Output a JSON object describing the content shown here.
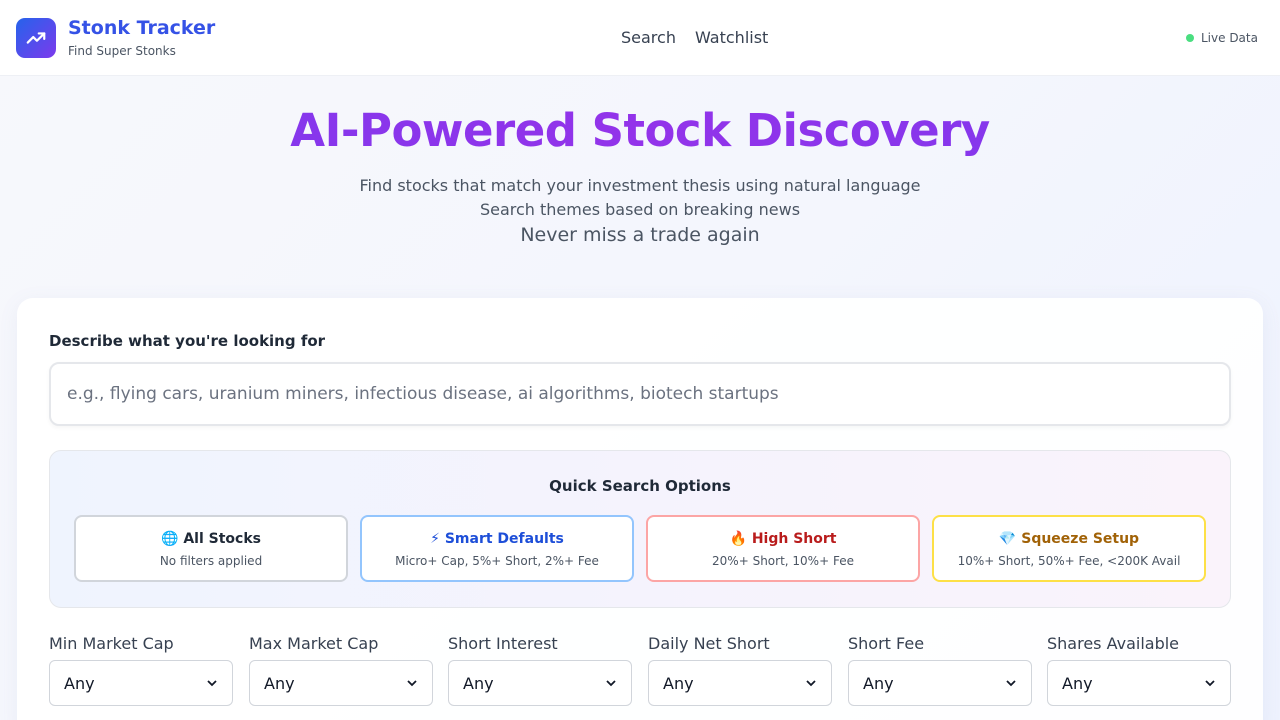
{
  "header": {
    "brand_title": "Stonk Tracker",
    "brand_subtitle": "Find Super Stonks",
    "nav": [
      "Search",
      "Watchlist"
    ],
    "status": "Live Data",
    "logo_icon": "trending-up-icon"
  },
  "hero": {
    "title": "AI-Powered Stock Discovery",
    "line1": "Find stocks that match your investment thesis using natural language",
    "line2": "Search themes based on breaking news",
    "line3": "Never miss a trade again"
  },
  "search": {
    "label": "Describe what you're looking for",
    "value": "",
    "placeholder": "e.g., flying cars, uranium miners, infectious disease, ai algorithms, biotech startups"
  },
  "quick": {
    "title": "Quick Search Options",
    "options": [
      {
        "icon": "🌐",
        "label": "All Stocks",
        "sub": "No filters applied",
        "color": "#1f2937",
        "border": "#d1d5db"
      },
      {
        "icon": "⚡",
        "label": "Smart Defaults",
        "sub": "Micro+ Cap, 5%+ Short, 2%+ Fee",
        "color": "#1d4ed8",
        "border": "#93c5fd"
      },
      {
        "icon": "🔥",
        "label": "High Short",
        "sub": "20%+ Short, 10%+ Fee",
        "color": "#b91c1c",
        "border": "#fca5a5"
      },
      {
        "icon": "💎",
        "label": "Squeeze Setup",
        "sub": "10%+ Short, 50%+ Fee, <200K Avail",
        "color": "#a16207",
        "border": "#fde047"
      }
    ]
  },
  "filters": [
    {
      "label": "Min Market Cap",
      "value": "Any"
    },
    {
      "label": "Max Market Cap",
      "value": "Any"
    },
    {
      "label": "Short Interest",
      "value": "Any"
    },
    {
      "label": "Daily Net Short",
      "value": "Any"
    },
    {
      "label": "Short Fee",
      "value": "Any"
    },
    {
      "label": "Shares Available",
      "value": "Any"
    }
  ]
}
